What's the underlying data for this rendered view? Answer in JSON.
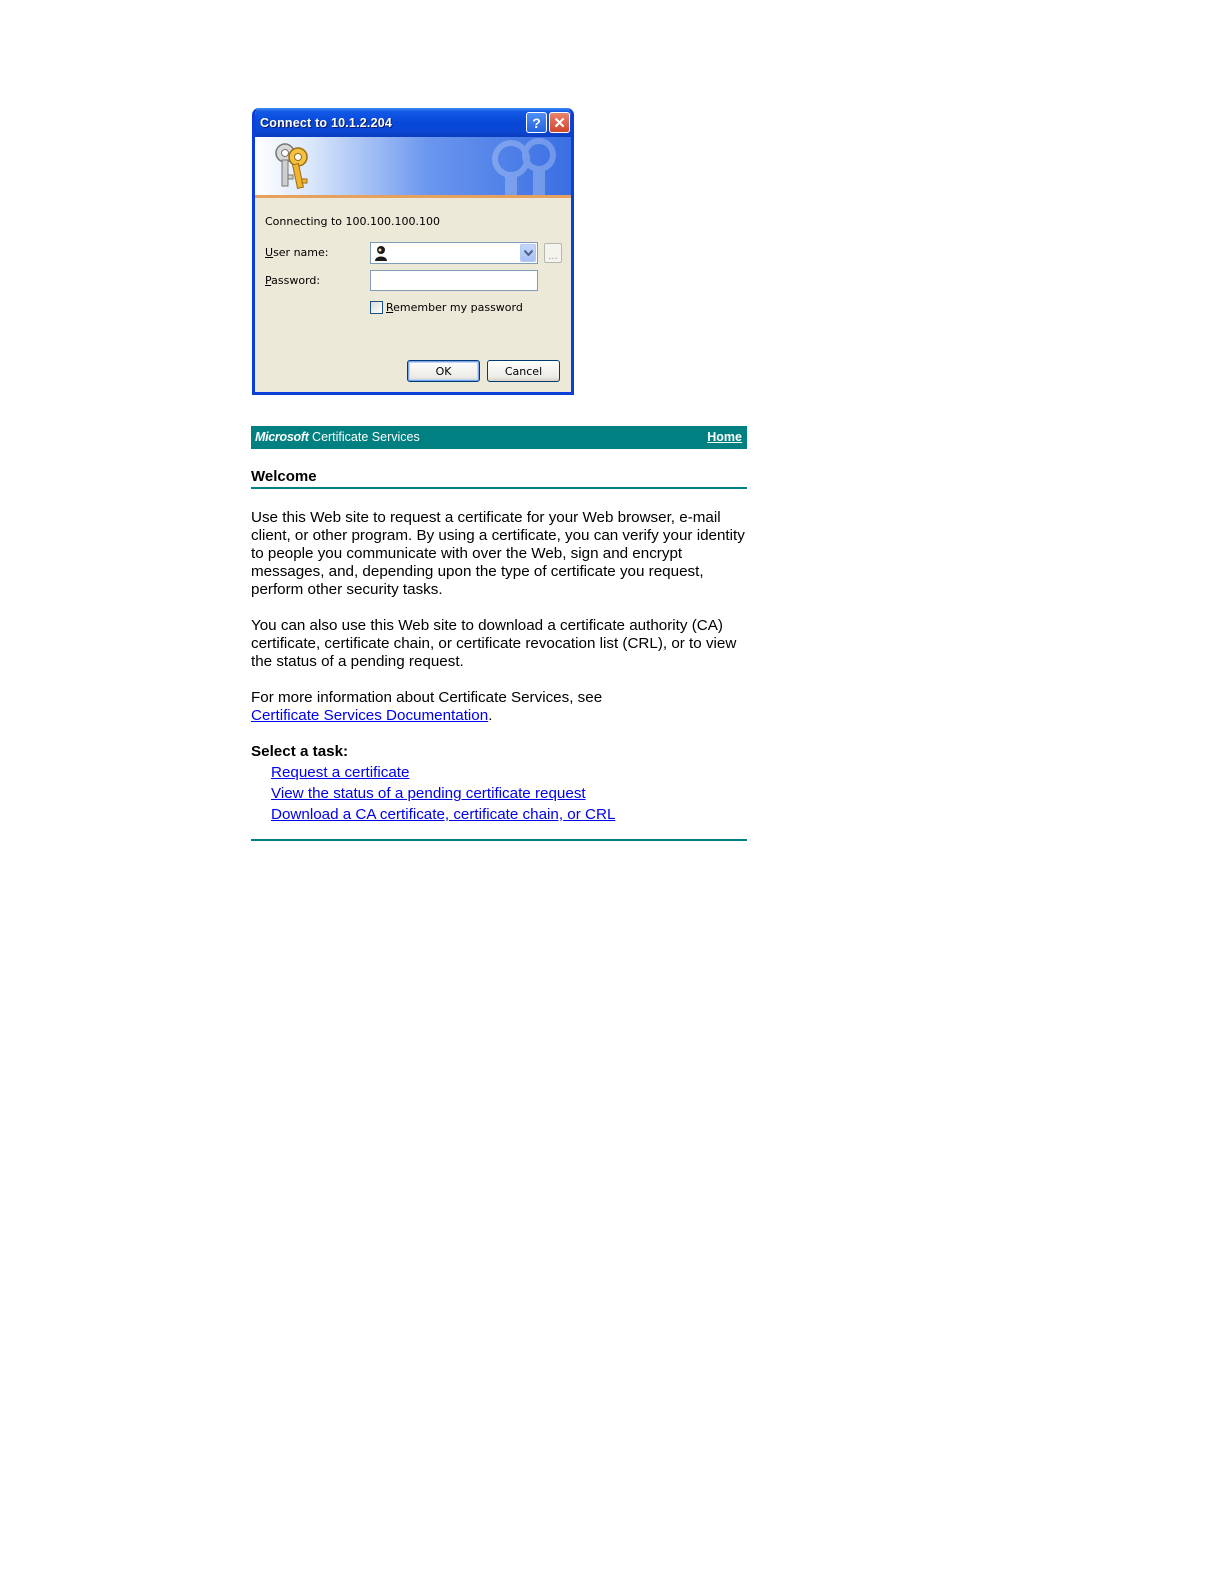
{
  "dialog": {
    "title": "Connect to 10.1.2.204",
    "help_glyph": "?",
    "close_glyph": "✕",
    "connecting_text": "Connecting to 100.100.100.100",
    "username_label_mnemonic": "U",
    "username_label_rest": "ser name:",
    "username_value": "",
    "password_label_mnemonic": "P",
    "password_label_rest": "assword:",
    "password_value": "",
    "remember_mnemonic": "R",
    "remember_rest": "emember my password",
    "remember_checked": false,
    "browse_label": "...",
    "ok_label": "OK",
    "cancel_label": "Cancel",
    "icons": [
      "keys-icon",
      "user-icon",
      "dropdown-arrow-icon",
      "help-icon",
      "close-icon"
    ]
  },
  "cert_services": {
    "brand_bold": "Microsoft",
    "brand_rest": " Certificate Services",
    "home_link": "Home",
    "welcome_heading": "Welcome",
    "paragraph1": "Use this Web site to request a certificate for your Web browser, e-mail client, or other program. By using a certificate, you can verify your identity to people you communicate with over the Web, sign and encrypt messages, and, depending upon the type of certificate you request, perform other security tasks.",
    "paragraph2": "You can also use this Web site to download a certificate authority (CA) certificate, certificate chain, or certificate revocation list (CRL), or to view the status of a pending request.",
    "paragraph3_text": "For more information about Certificate Services, see",
    "paragraph3_link": "Certificate Services Documentation",
    "paragraph3_end": ".",
    "select_task_label": "Select a task:",
    "tasks": [
      "Request a certificate",
      "View the status of a pending certificate request",
      "Download a CA certificate, certificate chain, or CRL"
    ],
    "colors": {
      "header_bg": "#008080",
      "link": "#0000ee"
    }
  }
}
